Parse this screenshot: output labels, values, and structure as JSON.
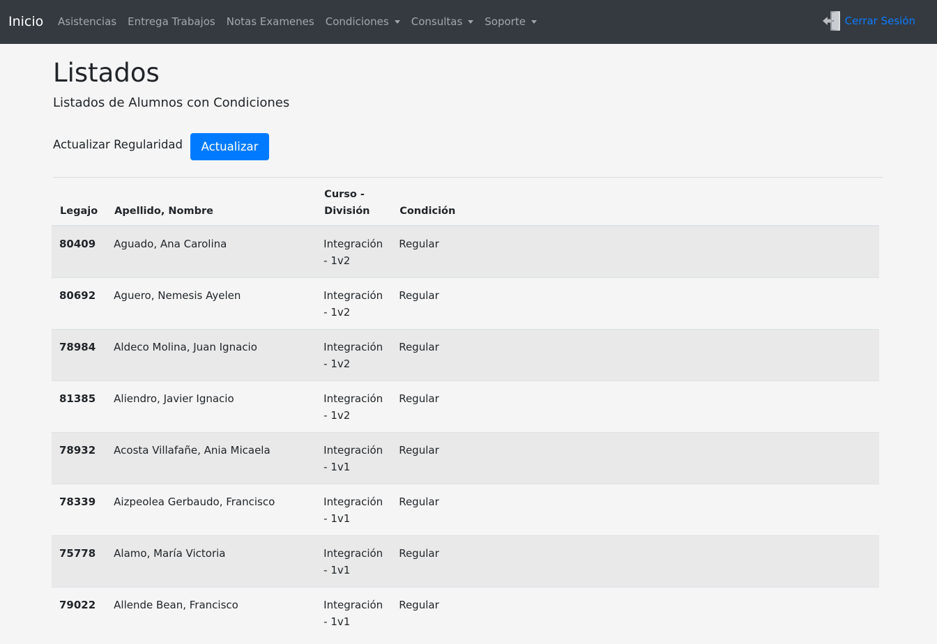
{
  "navbar": {
    "brand": "Inicio",
    "items": [
      {
        "label": "Asistencias",
        "dropdown": false
      },
      {
        "label": "Entrega Trabajos",
        "dropdown": false
      },
      {
        "label": "Notas Examenes",
        "dropdown": false
      },
      {
        "label": "Condiciones",
        "dropdown": true
      },
      {
        "label": "Consultas",
        "dropdown": true
      },
      {
        "label": "Soporte",
        "dropdown": true
      }
    ],
    "logout_label": "Cerrar Sesión",
    "logout_icon": "logout-door-icon"
  },
  "page": {
    "title": "Listados",
    "subtitle": "Listados de Alumnos con Condiciones",
    "update_label": "Actualizar Regularidad",
    "update_button": "Actualizar"
  },
  "table": {
    "headers": [
      "Legajo",
      "Apellido, Nombre",
      "Curso - División",
      "Condición"
    ],
    "rows": [
      {
        "legajo": "80409",
        "nombre": "Aguado, Ana Carolina",
        "curso": "Integración - 1v2",
        "condicion": "Regular"
      },
      {
        "legajo": "80692",
        "nombre": "Aguero, Nemesis Ayelen",
        "curso": "Integración - 1v2",
        "condicion": "Regular"
      },
      {
        "legajo": "78984",
        "nombre": "Aldeco Molina, Juan Ignacio",
        "curso": "Integración - 1v2",
        "condicion": "Regular"
      },
      {
        "legajo": "81385",
        "nombre": "Aliendro, Javier Ignacio",
        "curso": "Integración - 1v2",
        "condicion": "Regular"
      },
      {
        "legajo": "78932",
        "nombre": "Acosta Villafañe, Ania Micaela",
        "curso": "Integración - 1v1",
        "condicion": "Regular"
      },
      {
        "legajo": "78339",
        "nombre": "Aizpeolea Gerbaudo, Francisco",
        "curso": "Integración - 1v1",
        "condicion": "Regular"
      },
      {
        "legajo": "75778",
        "nombre": "Alamo, María Victoria",
        "curso": "Integración - 1v1",
        "condicion": "Regular"
      },
      {
        "legajo": "79022",
        "nombre": "Allende Bean, Francisco",
        "curso": "Integración - 1v1",
        "condicion": "Regular"
      }
    ]
  },
  "colors": {
    "navbar_bg": "#343a40",
    "primary": "#007bff",
    "link": "#0d7bff",
    "stripe": "#e9e9e9",
    "page_bg": "#f5f5f5"
  }
}
